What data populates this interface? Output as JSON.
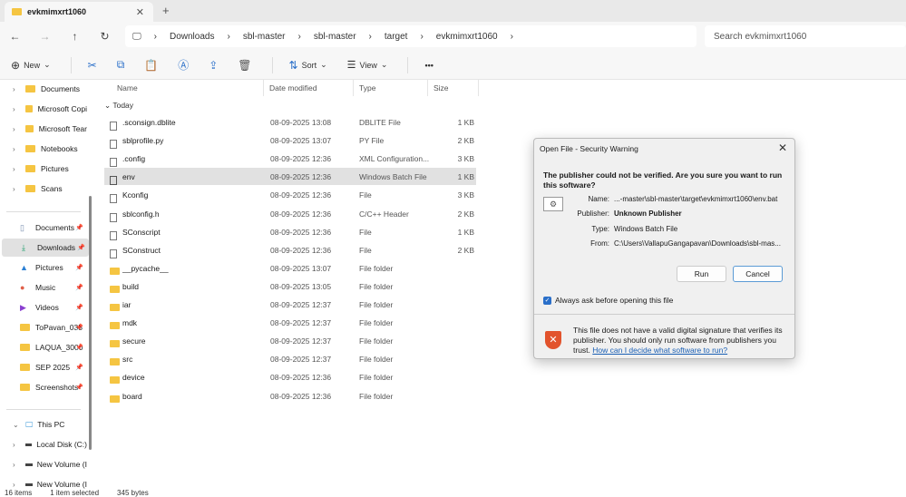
{
  "tab": {
    "title": "evkmimxrt1060",
    "close": "✕",
    "new": "+"
  },
  "nav": {
    "back": "←",
    "forward": "→",
    "up": "↑",
    "refresh": "↻",
    "breadcrumb": [
      "Downloads",
      "sbl-master",
      "sbl-master",
      "target",
      "evkmimxrt1060"
    ],
    "search_placeholder": "Search evkmimxrt1060"
  },
  "toolbar": {
    "new": "New",
    "sort": "Sort",
    "view": "View",
    "more": "•••"
  },
  "sidebar": {
    "top": [
      {
        "label": "Documents"
      },
      {
        "label": "Microsoft Copi"
      },
      {
        "label": "Microsoft Tear"
      },
      {
        "label": "Notebooks"
      },
      {
        "label": "Pictures"
      },
      {
        "label": "Scans"
      }
    ],
    "quick": [
      {
        "label": "Documents"
      },
      {
        "label": "Downloads"
      },
      {
        "label": "Pictures"
      },
      {
        "label": "Music"
      },
      {
        "label": "Videos"
      },
      {
        "label": "ToPavan_035"
      },
      {
        "label": "LAQUA_3000"
      },
      {
        "label": "SEP 2025"
      },
      {
        "label": "Screenshots"
      }
    ],
    "pc": {
      "label": "This PC",
      "drives": [
        {
          "label": "Local Disk (C:)"
        },
        {
          "label": "New Volume (I"
        },
        {
          "label": "New Volume (I"
        }
      ]
    }
  },
  "columns": {
    "name": "Name",
    "date": "Date modified",
    "type": "Type",
    "size": "Size"
  },
  "group": "Today",
  "files": [
    {
      "name": ".sconsign.dblite",
      "date": "08-09-2025 13:08",
      "type": "DBLITE File",
      "size": "1 KB",
      "kind": "file"
    },
    {
      "name": "sblprofile.py",
      "date": "08-09-2025 13:07",
      "type": "PY File",
      "size": "2 KB",
      "kind": "file"
    },
    {
      "name": ".config",
      "date": "08-09-2025 12:36",
      "type": "XML Configuration...",
      "size": "3 KB",
      "kind": "file"
    },
    {
      "name": "env",
      "date": "08-09-2025 12:36",
      "type": "Windows Batch File",
      "size": "1 KB",
      "kind": "bat"
    },
    {
      "name": "Kconfig",
      "date": "08-09-2025 12:36",
      "type": "File",
      "size": "3 KB",
      "kind": "file"
    },
    {
      "name": "sblconfig.h",
      "date": "08-09-2025 12:36",
      "type": "C/C++ Header",
      "size": "2 KB",
      "kind": "file"
    },
    {
      "name": "SConscript",
      "date": "08-09-2025 12:36",
      "type": "File",
      "size": "1 KB",
      "kind": "file"
    },
    {
      "name": "SConstruct",
      "date": "08-09-2025 12:36",
      "type": "File",
      "size": "2 KB",
      "kind": "file"
    },
    {
      "name": "__pycache__",
      "date": "08-09-2025 13:07",
      "type": "File folder",
      "size": "",
      "kind": "folder"
    },
    {
      "name": "build",
      "date": "08-09-2025 13:05",
      "type": "File folder",
      "size": "",
      "kind": "folder"
    },
    {
      "name": "iar",
      "date": "08-09-2025 12:37",
      "type": "File folder",
      "size": "",
      "kind": "folder"
    },
    {
      "name": "mdk",
      "date": "08-09-2025 12:37",
      "type": "File folder",
      "size": "",
      "kind": "folder"
    },
    {
      "name": "secure",
      "date": "08-09-2025 12:37",
      "type": "File folder",
      "size": "",
      "kind": "folder"
    },
    {
      "name": "src",
      "date": "08-09-2025 12:37",
      "type": "File folder",
      "size": "",
      "kind": "folder"
    },
    {
      "name": "device",
      "date": "08-09-2025 12:36",
      "type": "File folder",
      "size": "",
      "kind": "folder"
    },
    {
      "name": "board",
      "date": "08-09-2025 12:36",
      "type": "File folder",
      "size": "",
      "kind": "folder"
    }
  ],
  "status": {
    "count": "16 items",
    "selected": "1 item selected",
    "bytes": "345 bytes"
  },
  "dialog": {
    "title": "Open File - Security Warning",
    "close": "✕",
    "question": "The publisher could not be verified.  Are you sure you want to run this software?",
    "name_label": "Name:",
    "name": "...-master\\sbl-master\\target\\evkmimxrt1060\\env.bat",
    "publisher_label": "Publisher:",
    "publisher": "Unknown Publisher",
    "type_label": "Type:",
    "type": "Windows Batch File",
    "from_label": "From:",
    "from": "C:\\Users\\VallapuGangapavan\\Downloads\\sbl-mas...",
    "run": "Run",
    "cancel": "Cancel",
    "always_ask": "Always ask before opening this file",
    "warning": "This file does not have a valid digital signature that verifies its publisher.  You should only run software from publishers you trust.",
    "help_link": "How can I decide what software to run?"
  },
  "colors": {
    "accent": "#2a6fc9",
    "folder": "#f5c542",
    "shield": "#e2532c",
    "selection": "#e1e1e1"
  }
}
